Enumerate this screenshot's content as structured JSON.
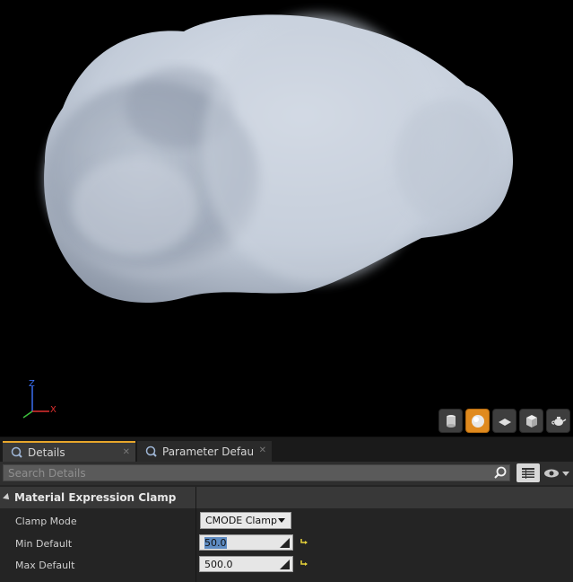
{
  "viewport": {
    "axis": {
      "z_label": "Z",
      "x_label": "X"
    },
    "toolbar": [
      {
        "icon": "cylinder-icon",
        "active": false
      },
      {
        "icon": "sphere-icon",
        "active": true
      },
      {
        "icon": "plane-icon",
        "active": false
      },
      {
        "icon": "cube-icon",
        "active": false
      },
      {
        "icon": "teapot-icon",
        "active": false
      }
    ]
  },
  "tabs": [
    {
      "label": "Details",
      "icon": "details-icon",
      "active": true
    },
    {
      "label": "Parameter Defaults",
      "icon": "details-icon",
      "active": false
    }
  ],
  "search": {
    "placeholder": "Search Details",
    "value": ""
  },
  "category": {
    "title": "Material Expression Clamp"
  },
  "properties": {
    "clamp_mode": {
      "label": "Clamp Mode",
      "value": "CMODE Clamp"
    },
    "min_default": {
      "label": "Min Default",
      "value": "50.0"
    },
    "max_default": {
      "label": "Max Default",
      "value": "500.0"
    }
  },
  "colors": {
    "accent": "#e8a72b",
    "active_toolbar": "#e08a1e",
    "selection": "#5d8bc2"
  }
}
